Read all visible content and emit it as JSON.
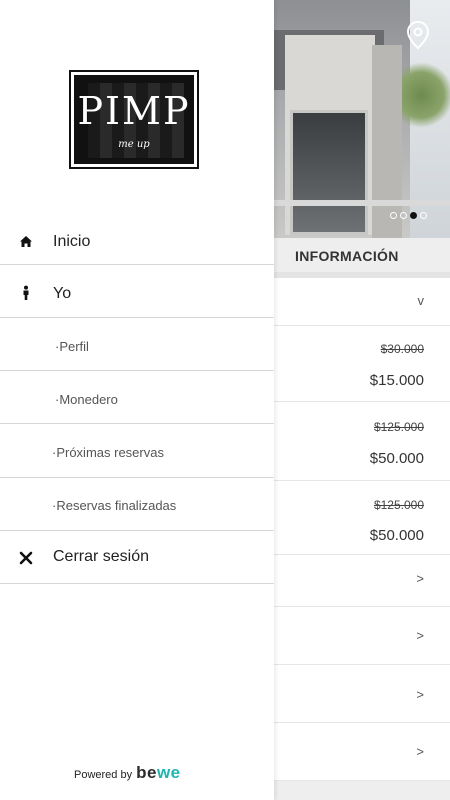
{
  "drawer": {
    "logo": {
      "word": "PIMP",
      "tagline": "me up"
    },
    "menu": [
      {
        "label": "Inicio",
        "icon": "home-icon"
      },
      {
        "label": "Yo",
        "icon": "person-icon"
      },
      {
        "label": "·Perfil"
      },
      {
        "label": "·Monedero"
      },
      {
        "label": "·Próximas reservas"
      },
      {
        "label": "·Reservas finalizadas"
      },
      {
        "label": "Cerrar sesión",
        "icon": "close-icon"
      }
    ],
    "footer": {
      "powered_by": "Powered by",
      "brand_a": "be",
      "brand_b": "we"
    }
  },
  "background": {
    "carousel": {
      "slides": 4,
      "active_index": 2
    },
    "section_title": "INFORMACIÓN",
    "rows": [
      {
        "kind": "toggle",
        "chevron": "v"
      },
      {
        "kind": "price",
        "old": "$30.000",
        "new": "$15.000"
      },
      {
        "kind": "price",
        "old": "$125.000",
        "new": "$50.000"
      },
      {
        "kind": "price",
        "old": "$125.000",
        "new": "$50.000"
      },
      {
        "kind": "link",
        "chevron": ">"
      },
      {
        "kind": "link",
        "chevron": ">"
      },
      {
        "kind": "link",
        "chevron": ">"
      },
      {
        "kind": "link",
        "chevron": ">"
      }
    ]
  },
  "colors": {
    "accent": "#1fb6b0",
    "text": "#222222",
    "divider": "#d8d8d8"
  }
}
